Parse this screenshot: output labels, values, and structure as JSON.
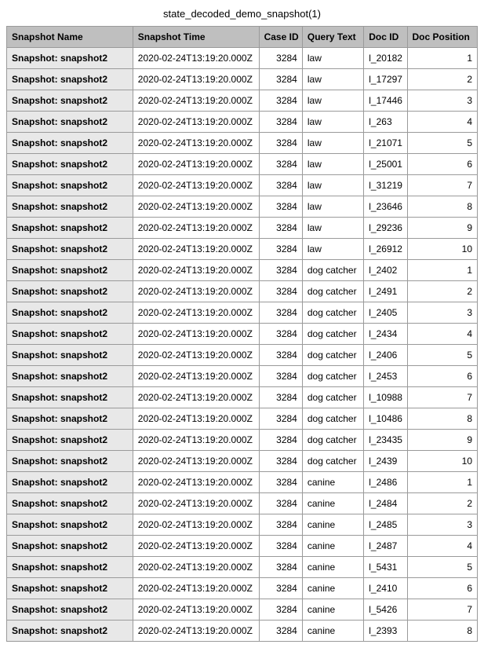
{
  "title": "state_decoded_demo_snapshot(1)",
  "headers": {
    "name": "Snapshot Name",
    "time": "Snapshot Time",
    "caseid": "Case ID",
    "query": "Query Text",
    "docid": "Doc ID",
    "docpos": "Doc Position"
  },
  "rows": [
    {
      "name": "Snapshot: snapshot2",
      "time": "2020-02-24T13:19:20.000Z",
      "caseid": "3284",
      "query": "law",
      "docid": "l_20182",
      "docpos": "1"
    },
    {
      "name": "Snapshot: snapshot2",
      "time": "2020-02-24T13:19:20.000Z",
      "caseid": "3284",
      "query": "law",
      "docid": "l_17297",
      "docpos": "2"
    },
    {
      "name": "Snapshot: snapshot2",
      "time": "2020-02-24T13:19:20.000Z",
      "caseid": "3284",
      "query": "law",
      "docid": "l_17446",
      "docpos": "3"
    },
    {
      "name": "Snapshot: snapshot2",
      "time": "2020-02-24T13:19:20.000Z",
      "caseid": "3284",
      "query": "law",
      "docid": "l_263",
      "docpos": "4"
    },
    {
      "name": "Snapshot: snapshot2",
      "time": "2020-02-24T13:19:20.000Z",
      "caseid": "3284",
      "query": "law",
      "docid": "l_21071",
      "docpos": "5"
    },
    {
      "name": "Snapshot: snapshot2",
      "time": "2020-02-24T13:19:20.000Z",
      "caseid": "3284",
      "query": "law",
      "docid": "l_25001",
      "docpos": "6"
    },
    {
      "name": "Snapshot: snapshot2",
      "time": "2020-02-24T13:19:20.000Z",
      "caseid": "3284",
      "query": "law",
      "docid": "l_31219",
      "docpos": "7"
    },
    {
      "name": "Snapshot: snapshot2",
      "time": "2020-02-24T13:19:20.000Z",
      "caseid": "3284",
      "query": "law",
      "docid": "l_23646",
      "docpos": "8"
    },
    {
      "name": "Snapshot: snapshot2",
      "time": "2020-02-24T13:19:20.000Z",
      "caseid": "3284",
      "query": "law",
      "docid": "l_29236",
      "docpos": "9"
    },
    {
      "name": "Snapshot: snapshot2",
      "time": "2020-02-24T13:19:20.000Z",
      "caseid": "3284",
      "query": "law",
      "docid": "l_26912",
      "docpos": "10"
    },
    {
      "name": "Snapshot: snapshot2",
      "time": "2020-02-24T13:19:20.000Z",
      "caseid": "3284",
      "query": "dog catcher",
      "docid": "l_2402",
      "docpos": "1"
    },
    {
      "name": "Snapshot: snapshot2",
      "time": "2020-02-24T13:19:20.000Z",
      "caseid": "3284",
      "query": "dog catcher",
      "docid": "l_2491",
      "docpos": "2"
    },
    {
      "name": "Snapshot: snapshot2",
      "time": "2020-02-24T13:19:20.000Z",
      "caseid": "3284",
      "query": "dog catcher",
      "docid": "l_2405",
      "docpos": "3"
    },
    {
      "name": "Snapshot: snapshot2",
      "time": "2020-02-24T13:19:20.000Z",
      "caseid": "3284",
      "query": "dog catcher",
      "docid": "l_2434",
      "docpos": "4"
    },
    {
      "name": "Snapshot: snapshot2",
      "time": "2020-02-24T13:19:20.000Z",
      "caseid": "3284",
      "query": "dog catcher",
      "docid": "l_2406",
      "docpos": "5"
    },
    {
      "name": "Snapshot: snapshot2",
      "time": "2020-02-24T13:19:20.000Z",
      "caseid": "3284",
      "query": "dog catcher",
      "docid": "l_2453",
      "docpos": "6"
    },
    {
      "name": "Snapshot: snapshot2",
      "time": "2020-02-24T13:19:20.000Z",
      "caseid": "3284",
      "query": "dog catcher",
      "docid": "l_10988",
      "docpos": "7"
    },
    {
      "name": "Snapshot: snapshot2",
      "time": "2020-02-24T13:19:20.000Z",
      "caseid": "3284",
      "query": "dog catcher",
      "docid": "l_10486",
      "docpos": "8"
    },
    {
      "name": "Snapshot: snapshot2",
      "time": "2020-02-24T13:19:20.000Z",
      "caseid": "3284",
      "query": "dog catcher",
      "docid": "l_23435",
      "docpos": "9"
    },
    {
      "name": "Snapshot: snapshot2",
      "time": "2020-02-24T13:19:20.000Z",
      "caseid": "3284",
      "query": "dog catcher",
      "docid": "l_2439",
      "docpos": "10"
    },
    {
      "name": "Snapshot: snapshot2",
      "time": "2020-02-24T13:19:20.000Z",
      "caseid": "3284",
      "query": "canine",
      "docid": "l_2486",
      "docpos": "1"
    },
    {
      "name": "Snapshot: snapshot2",
      "time": "2020-02-24T13:19:20.000Z",
      "caseid": "3284",
      "query": "canine",
      "docid": "l_2484",
      "docpos": "2"
    },
    {
      "name": "Snapshot: snapshot2",
      "time": "2020-02-24T13:19:20.000Z",
      "caseid": "3284",
      "query": "canine",
      "docid": "l_2485",
      "docpos": "3"
    },
    {
      "name": "Snapshot: snapshot2",
      "time": "2020-02-24T13:19:20.000Z",
      "caseid": "3284",
      "query": "canine",
      "docid": "l_2487",
      "docpos": "4"
    },
    {
      "name": "Snapshot: snapshot2",
      "time": "2020-02-24T13:19:20.000Z",
      "caseid": "3284",
      "query": "canine",
      "docid": "l_5431",
      "docpos": "5"
    },
    {
      "name": "Snapshot: snapshot2",
      "time": "2020-02-24T13:19:20.000Z",
      "caseid": "3284",
      "query": "canine",
      "docid": "l_2410",
      "docpos": "6"
    },
    {
      "name": "Snapshot: snapshot2",
      "time": "2020-02-24T13:19:20.000Z",
      "caseid": "3284",
      "query": "canine",
      "docid": "l_5426",
      "docpos": "7"
    },
    {
      "name": "Snapshot: snapshot2",
      "time": "2020-02-24T13:19:20.000Z",
      "caseid": "3284",
      "query": "canine",
      "docid": "l_2393",
      "docpos": "8"
    }
  ]
}
